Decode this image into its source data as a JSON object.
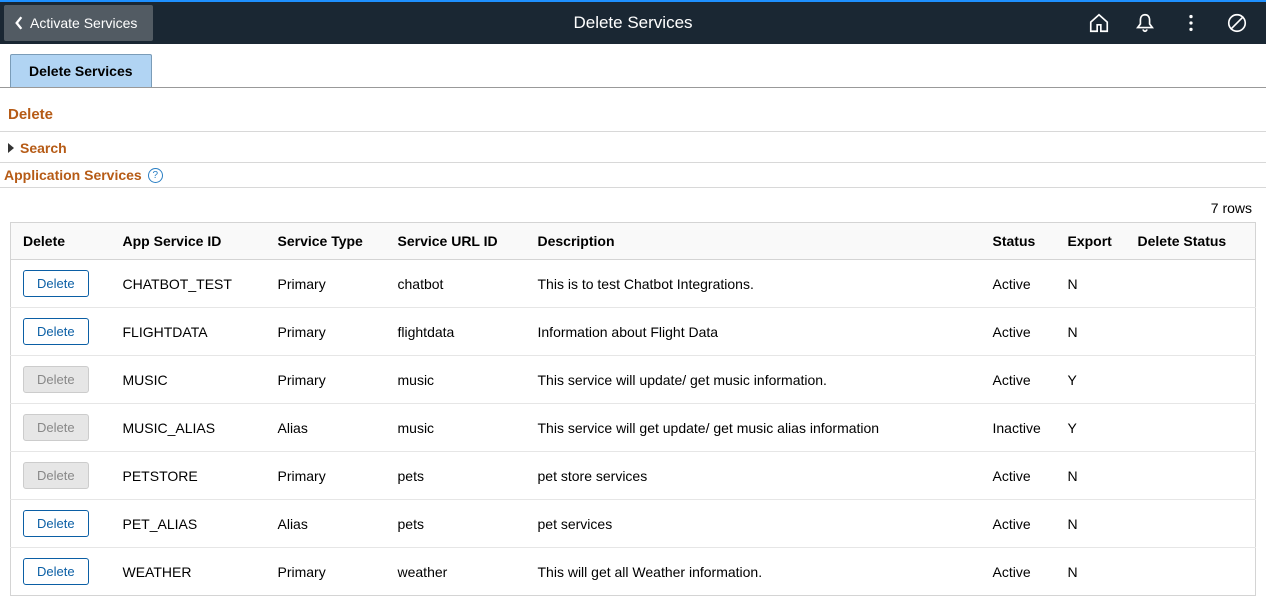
{
  "header": {
    "back_label": "Activate Services",
    "title": "Delete Services"
  },
  "tabs": {
    "main": "Delete Services"
  },
  "sections": {
    "delete_title": "Delete",
    "search_label": "Search",
    "app_services_label": "Application Services"
  },
  "table": {
    "rows_label": "7 rows",
    "columns": {
      "delete": "Delete",
      "app_service_id": "App Service ID",
      "service_type": "Service Type",
      "service_url_id": "Service URL ID",
      "description": "Description",
      "status": "Status",
      "export": "Export",
      "delete_status": "Delete Status"
    },
    "delete_button_label": "Delete",
    "rows": [
      {
        "enabled": true,
        "app_id": "CHATBOT_TEST",
        "type": "Primary",
        "url_id": "chatbot",
        "desc": "This is to test Chatbot Integrations.",
        "status": "Active",
        "export": "N",
        "delete_status": ""
      },
      {
        "enabled": true,
        "app_id": "FLIGHTDATA",
        "type": "Primary",
        "url_id": "flightdata",
        "desc": "Information about Flight Data",
        "status": "Active",
        "export": "N",
        "delete_status": ""
      },
      {
        "enabled": false,
        "app_id": "MUSIC",
        "type": "Primary",
        "url_id": "music",
        "desc": "This service will update/ get music information.",
        "status": "Active",
        "export": "Y",
        "delete_status": ""
      },
      {
        "enabled": false,
        "app_id": "MUSIC_ALIAS",
        "type": "Alias",
        "url_id": "music",
        "desc": "This service will get update/ get music alias information",
        "status": "Inactive",
        "export": "Y",
        "delete_status": ""
      },
      {
        "enabled": false,
        "app_id": "PETSTORE",
        "type": "Primary",
        "url_id": "pets",
        "desc": "pet store services",
        "status": "Active",
        "export": "N",
        "delete_status": ""
      },
      {
        "enabled": true,
        "app_id": "PET_ALIAS",
        "type": "Alias",
        "url_id": "pets",
        "desc": "pet services",
        "status": "Active",
        "export": "N",
        "delete_status": ""
      },
      {
        "enabled": true,
        "app_id": "WEATHER",
        "type": "Primary",
        "url_id": "weather",
        "desc": "This will get all Weather information.",
        "status": "Active",
        "export": "N",
        "delete_status": ""
      }
    ]
  }
}
